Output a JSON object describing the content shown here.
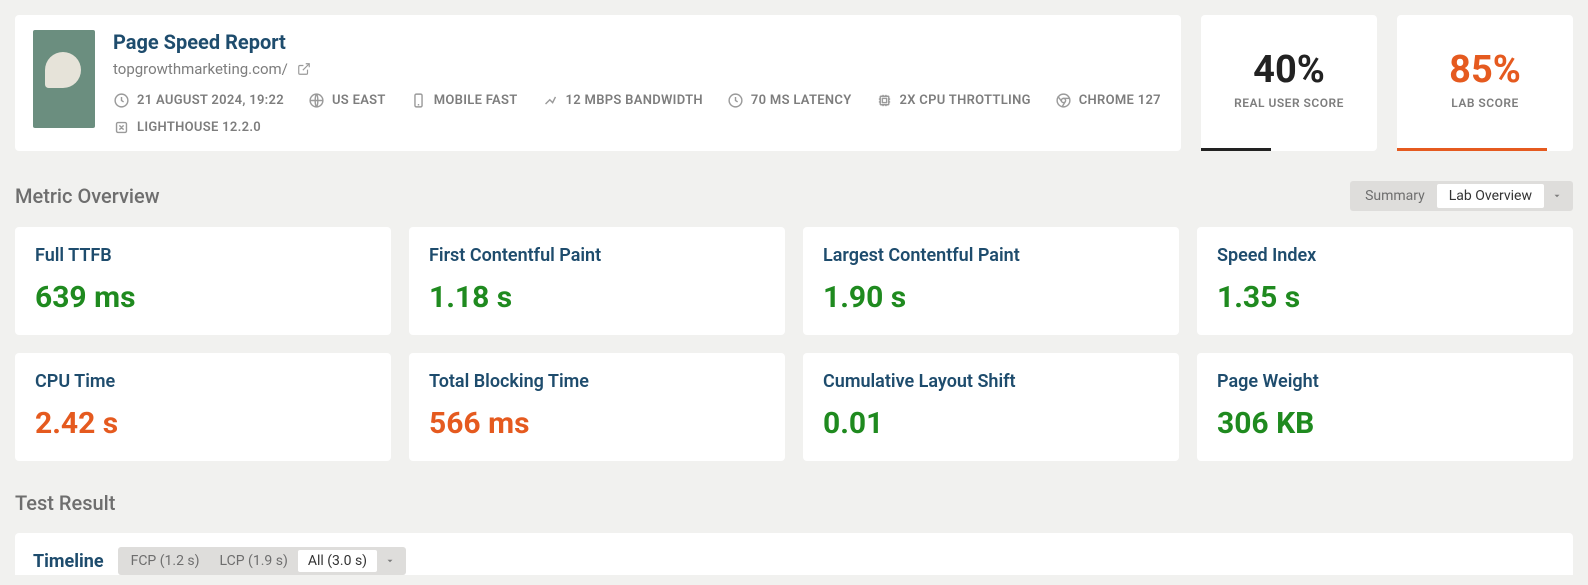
{
  "header": {
    "title": "Page Speed Report",
    "url": "topgrowthmarketing.com/",
    "badges": {
      "timestamp": "21 AUGUST 2024, 19:22",
      "region": "US EAST",
      "device": "MOBILE FAST",
      "bandwidth": "12 MBPS BANDWIDTH",
      "latency": "70 MS LATENCY",
      "cpu": "2X CPU THROTTLING",
      "browser": "CHROME 127",
      "lighthouse": "LIGHTHOUSE 12.2.0"
    }
  },
  "scores": {
    "realUser": {
      "value": "40%",
      "label": "REAL USER SCORE"
    },
    "lab": {
      "value": "85%",
      "label": "LAB SCORE"
    }
  },
  "sections": {
    "metricsTitle": "Metric Overview",
    "toggle": {
      "summary": "Summary",
      "labOverview": "Lab Overview"
    },
    "testResultTitle": "Test Result",
    "timelineLabel": "Timeline",
    "timelineTabs": {
      "fcp": "FCP (1.2 s)",
      "lcp": "LCP (1.9 s)",
      "all": "All (3.0 s)"
    }
  },
  "metrics": [
    {
      "label": "Full TTFB",
      "value": "639 ms",
      "color": "green"
    },
    {
      "label": "First Contentful Paint",
      "value": "1.18 s",
      "color": "green"
    },
    {
      "label": "Largest Contentful Paint",
      "value": "1.90 s",
      "color": "green"
    },
    {
      "label": "Speed Index",
      "value": "1.35 s",
      "color": "green"
    },
    {
      "label": "CPU Time",
      "value": "2.42 s",
      "color": "orange"
    },
    {
      "label": "Total Blocking Time",
      "value": "566 ms",
      "color": "orange"
    },
    {
      "label": "Cumulative Layout Shift",
      "value": "0.01",
      "color": "green"
    },
    {
      "label": "Page Weight",
      "value": "306 KB",
      "color": "green"
    }
  ]
}
